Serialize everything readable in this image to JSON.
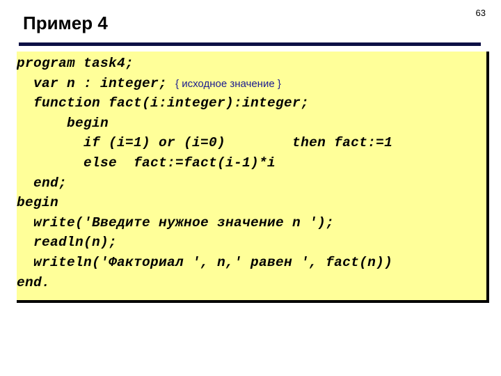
{
  "slide": {
    "page_number": "63",
    "title": "Пример 4",
    "accent_rule_color": "#0d1045",
    "code_panel_background": "#ffff99",
    "comment_color": "#1b1b8f"
  },
  "code": {
    "language": "Pascal",
    "lines": [
      {
        "text": "program task4;"
      },
      {
        "text": "  var n : integer; ",
        "comment": "{ исходное значение }"
      },
      {
        "text": "  function fact(i:integer):integer;"
      },
      {
        "text": "      begin"
      },
      {
        "text": "        if (i=1) or (i=0)        then fact:=1"
      },
      {
        "text": "        else  fact:=fact(i-1)*i"
      },
      {
        "text": "  end;"
      },
      {
        "text": "begin"
      },
      {
        "text": "  write('Введите нужное значение n ');"
      },
      {
        "text": "  readln(n);"
      },
      {
        "text": "  writeln('Факториал ', n,' равен ', fact(n))"
      },
      {
        "text": "end."
      }
    ]
  }
}
